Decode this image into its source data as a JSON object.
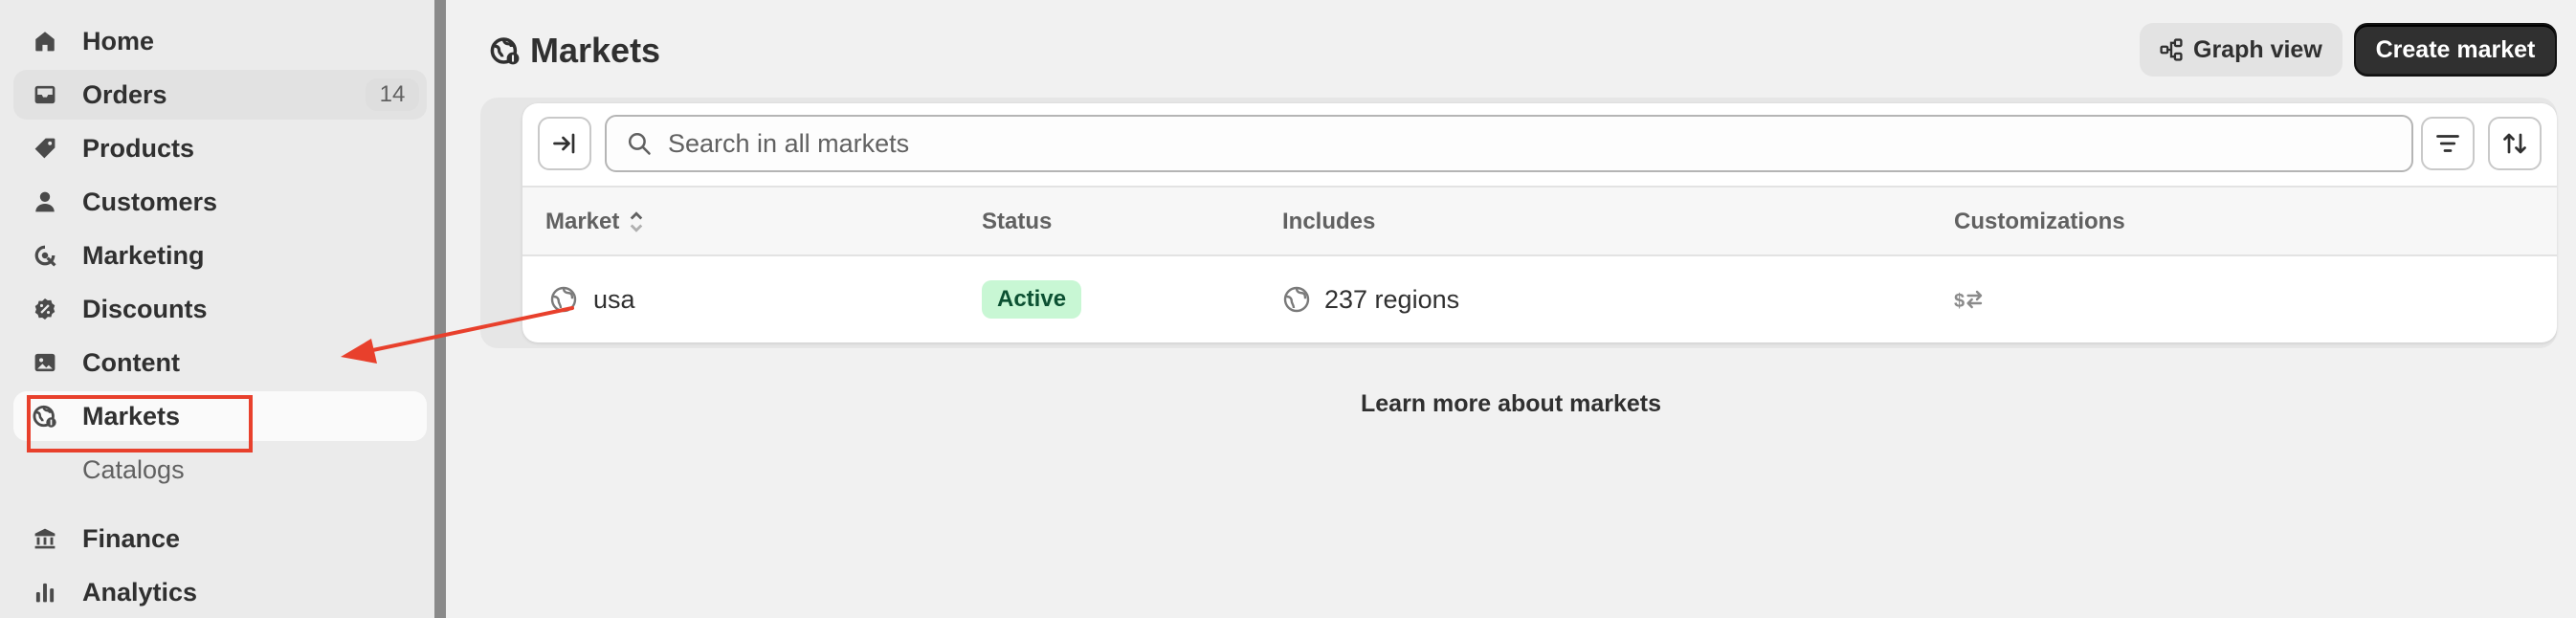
{
  "sidebar": {
    "items": [
      {
        "label": "Home",
        "icon": "home-icon"
      },
      {
        "label": "Orders",
        "icon": "inbox-icon",
        "badge": "14"
      },
      {
        "label": "Products",
        "icon": "tag-icon"
      },
      {
        "label": "Customers",
        "icon": "person-icon"
      },
      {
        "label": "Marketing",
        "icon": "target-icon"
      },
      {
        "label": "Discounts",
        "icon": "discount-icon"
      },
      {
        "label": "Content",
        "icon": "image-icon"
      },
      {
        "label": "Markets",
        "icon": "globe-icon"
      },
      {
        "label": "Catalogs"
      },
      {
        "label": "Finance",
        "icon": "bank-icon"
      },
      {
        "label": "Analytics",
        "icon": "bar-chart-icon"
      }
    ]
  },
  "header": {
    "title": "Markets",
    "graph_view_label": "Graph view",
    "create_label": "Create market"
  },
  "search": {
    "placeholder": "Search in all markets"
  },
  "table": {
    "columns": [
      "Market",
      "Status",
      "Includes",
      "Customizations"
    ],
    "rows": [
      {
        "market": "usa",
        "status": "Active",
        "includes": "237 regions",
        "customizations_icon": "currency-exchange-icon"
      }
    ]
  },
  "footer": {
    "learn_more": "Learn more about markets"
  },
  "colors": {
    "annotation": "#e8402c",
    "active_badge_bg": "#c8f7d4",
    "active_badge_text": "#0c5132",
    "primary_button": "#303030"
  }
}
